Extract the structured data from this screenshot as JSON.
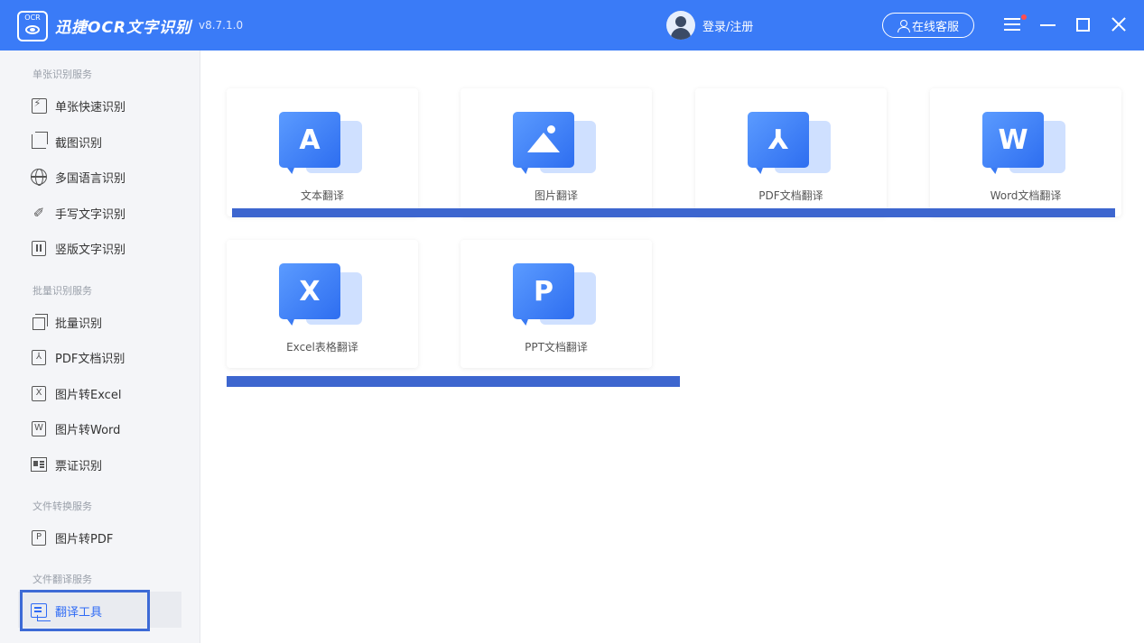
{
  "app": {
    "title": "迅捷OCR文字识别",
    "version": "v8.7.1.0",
    "login_label": "登录/注册",
    "service_label": "在线客服"
  },
  "sidebar": {
    "sections": [
      {
        "title": "单张识别服务",
        "items": [
          "单张快速识别",
          "截图识别",
          "多国语言识别",
          "手写文字识别",
          "竖版文字识别"
        ]
      },
      {
        "title": "批量识别服务",
        "items": [
          "批量识别",
          "PDF文档识别",
          "图片转Excel",
          "图片转Word",
          "票证识别"
        ]
      },
      {
        "title": "文件转换服务",
        "items": [
          "图片转PDF"
        ]
      },
      {
        "title": "文件翻译服务",
        "items": [
          "翻译工具"
        ]
      }
    ],
    "icon_letters": {
      "pdf": "⅄",
      "excel": "X",
      "word": "W",
      "topdf": "P"
    }
  },
  "main": {
    "cards": [
      {
        "label": "文本翻译",
        "icon_letter": "A",
        "icon": "text-translate-icon"
      },
      {
        "label": "图片翻译",
        "icon_letter": "",
        "icon": "image-translate-icon"
      },
      {
        "label": "PDF文档翻译",
        "icon_letter": "⅄",
        "icon": "pdf-translate-icon"
      },
      {
        "label": "Word文档翻译",
        "icon_letter": "W",
        "icon": "word-translate-icon"
      },
      {
        "label": "Excel表格翻译",
        "icon_letter": "X",
        "icon": "excel-translate-icon"
      },
      {
        "label": "PPT文档翻译",
        "icon_letter": "P",
        "icon": "ppt-translate-icon"
      }
    ]
  },
  "colors": {
    "accent": "#3a7bf7",
    "highlight": "#3d66cf",
    "active_text": "#2f6bf5"
  }
}
